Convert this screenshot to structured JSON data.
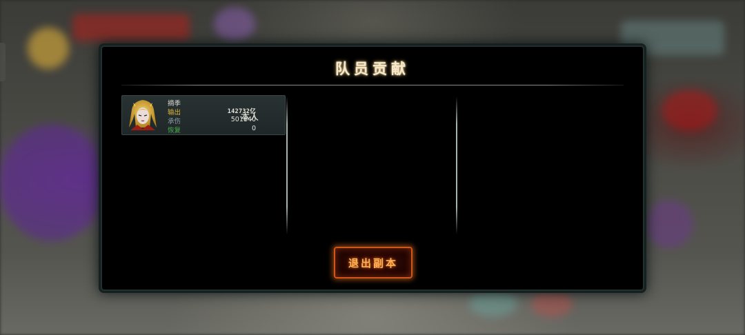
{
  "dialog": {
    "title": "队员贡献"
  },
  "member": {
    "name": "摘季",
    "self_tag": "本人",
    "stats": [
      {
        "label": "输出",
        "value": "142732亿"
      },
      {
        "label": "承伤",
        "value": "501840"
      },
      {
        "label": "恢复",
        "value": "0"
      }
    ]
  },
  "actions": {
    "exit_label": "退出副本"
  },
  "colors": {
    "output_label": "#e0b93a",
    "damage_taken_label": "#8b9ea4",
    "heal_label": "#4bb04b",
    "exit_border": "#d0561a"
  },
  "icons": {
    "avatar": "character-portrait-icon"
  }
}
